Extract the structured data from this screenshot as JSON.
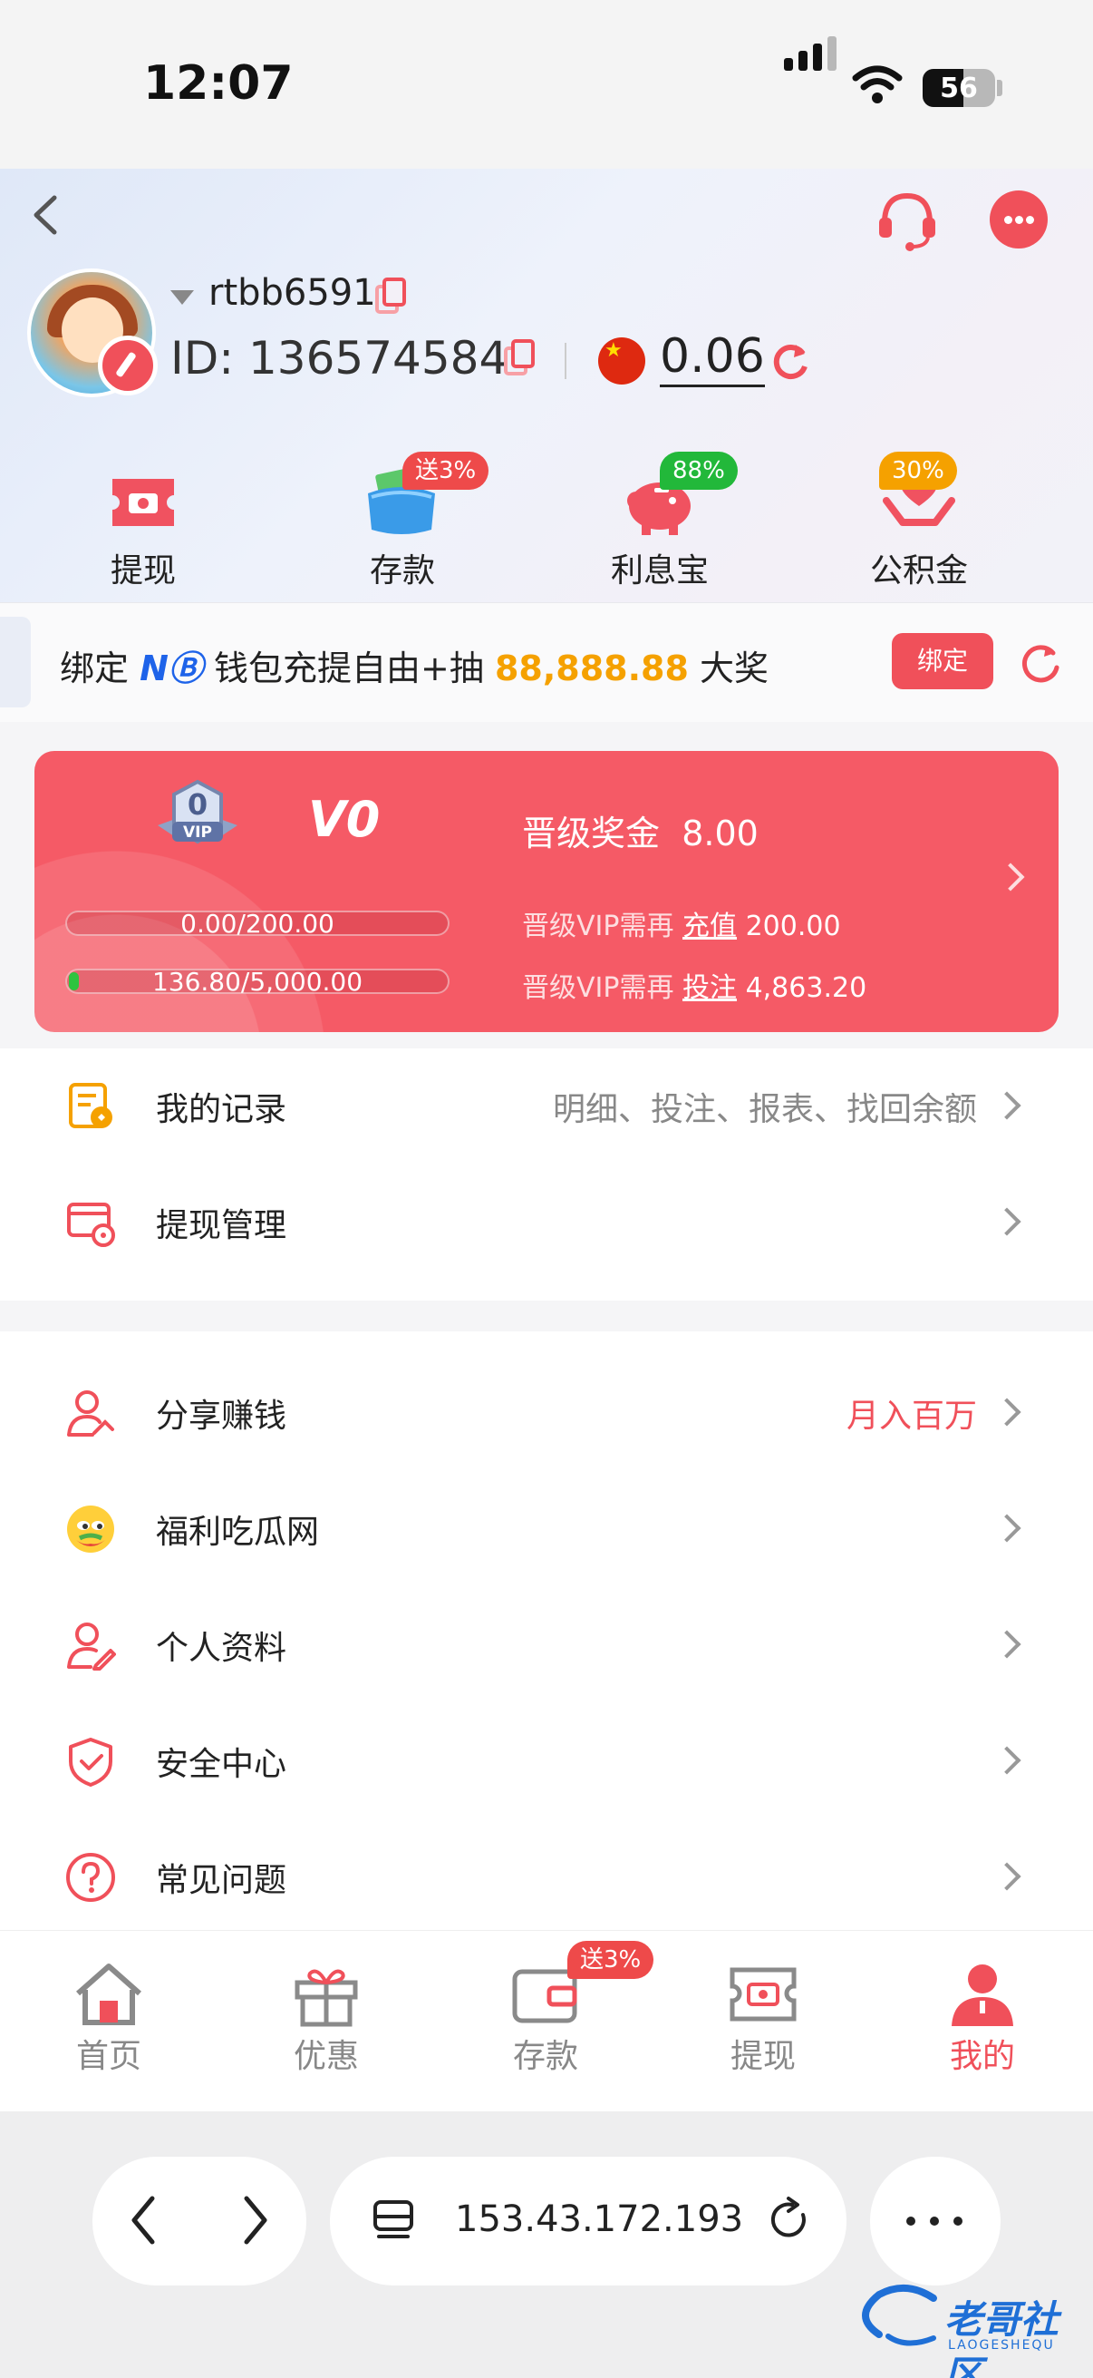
{
  "status_bar": {
    "time": "12:07",
    "battery": "56"
  },
  "header": {
    "username": "rtbb6591",
    "user_id": "ID: 136574584",
    "balance": "0.06",
    "quick_actions": [
      {
        "label": "提现",
        "badge": ""
      },
      {
        "label": "存款",
        "badge": "送3%"
      },
      {
        "label": "利息宝",
        "badge": "88%"
      },
      {
        "label": "公积金",
        "badge": "30%"
      }
    ],
    "colors": {
      "accent": "#f0505a",
      "badge_green": "#22b83a",
      "badge_orange": "#f5a100"
    }
  },
  "promo": {
    "prefix": "绑定",
    "brand": "NⒷ",
    "middle": "钱包充提自由+抽",
    "amount": "88,888.88",
    "suffix": "大奖",
    "bind_label": "绑定"
  },
  "vip": {
    "badge_number": "0",
    "badge_text": "VIP",
    "level": "V0",
    "bonus_label": "晋级奖金",
    "bonus_value": "8.00",
    "deposit_progress": "0.00/200.00",
    "deposit_progress_fraction": 0.0,
    "bet_progress": "136.80/5,000.00",
    "bet_progress_fraction": 0.027,
    "line1_prefix": "晋级VIP需再",
    "line1_action": "充值",
    "line1_value": "200.00",
    "line2_prefix": "晋级VIP需再",
    "line2_action": "投注",
    "line2_value": "4,863.20"
  },
  "menu_section1": [
    {
      "label": "我的记录",
      "extra": "明细、投注、报表、找回余额",
      "icon": "records-icon"
    },
    {
      "label": "提现管理",
      "extra": "",
      "icon": "withdraw-manage-icon"
    }
  ],
  "menu_section2": [
    {
      "label": "分享赚钱",
      "extra": "月入百万",
      "icon": "share-earn-icon"
    },
    {
      "label": "福利吃瓜网",
      "extra": "",
      "icon": "emoji-face-icon"
    },
    {
      "label": "个人资料",
      "extra": "",
      "icon": "profile-icon"
    },
    {
      "label": "安全中心",
      "extra": "",
      "icon": "shield-icon"
    },
    {
      "label": "常见问题",
      "extra": "",
      "icon": "question-icon"
    }
  ],
  "tabbar": {
    "tabs": [
      {
        "label": "首页",
        "icon": "home-icon"
      },
      {
        "label": "优惠",
        "icon": "gift-icon"
      },
      {
        "label": "存款",
        "icon": "wallet-icon"
      },
      {
        "label": "提现",
        "icon": "ticket-icon"
      },
      {
        "label": "我的",
        "icon": "user-icon"
      }
    ],
    "deposit_badge": "送3%",
    "active_index": 4
  },
  "browser": {
    "url": "153.43.172.193"
  },
  "watermark": {
    "text": "老哥社区",
    "sub": "LAOGESHEQU"
  }
}
